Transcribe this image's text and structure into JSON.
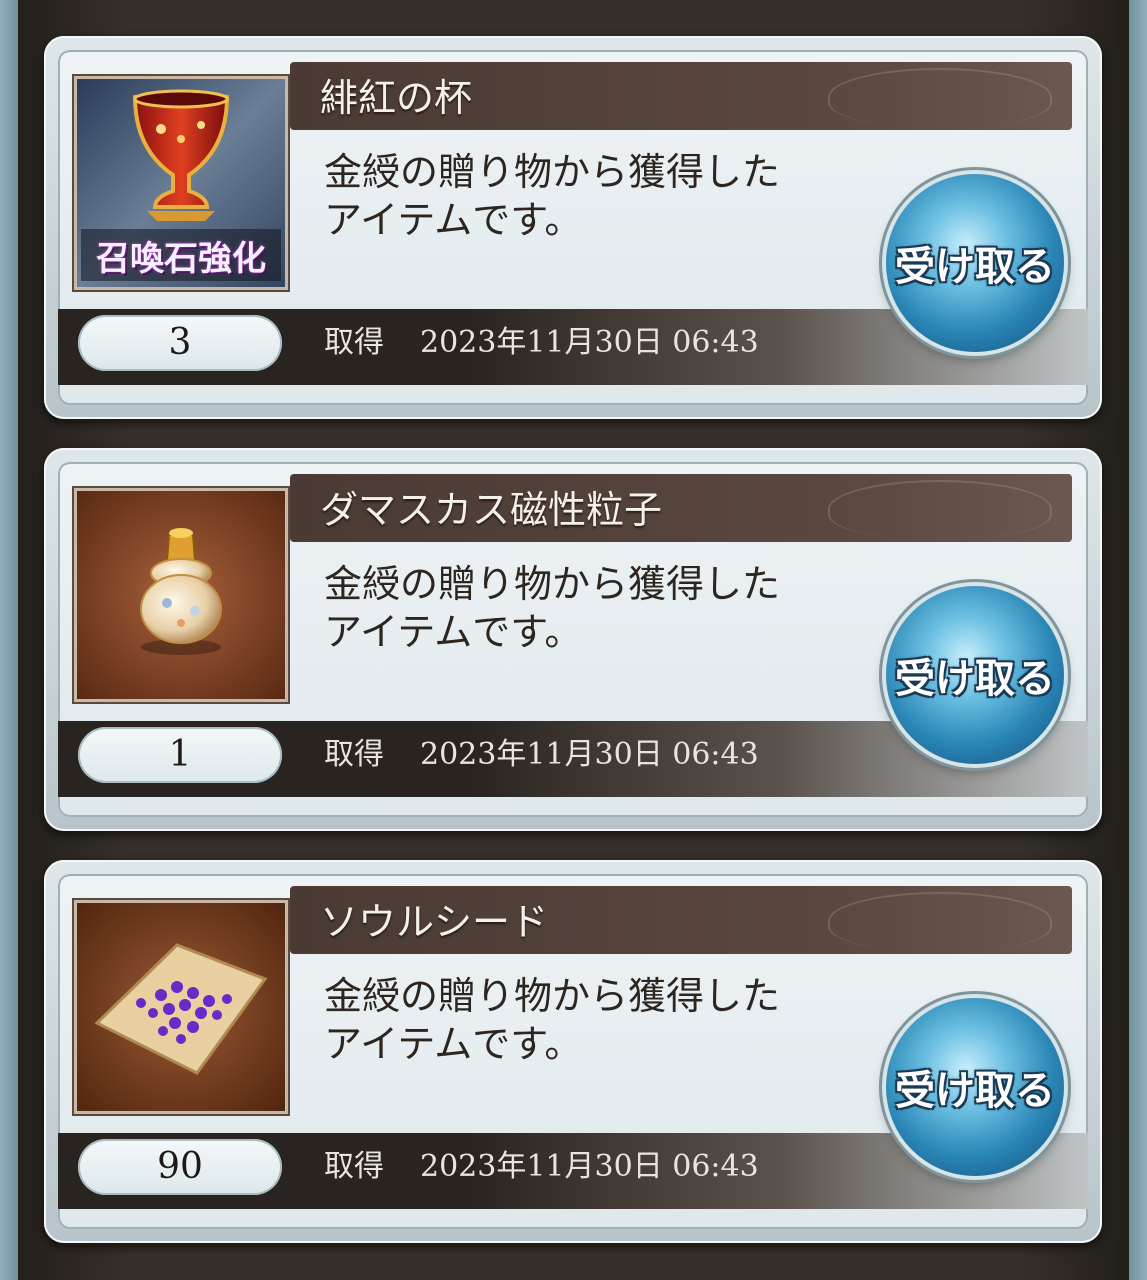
{
  "items": [
    {
      "title": "緋紅の杯",
      "description_line1": "金綬の贈り物から獲得した",
      "description_line2": "アイテムです。",
      "quantity": "3",
      "acquired_label": "取得",
      "acquired_date": "2023年11月30日 06:43",
      "receive_label": "受け取る",
      "icon_caption": "召喚石強化",
      "icon": "crimson-cup-icon"
    },
    {
      "title": "ダマスカス磁性粒子",
      "description_line1": "金綬の贈り物から獲得した",
      "description_line2": "アイテムです。",
      "quantity": "1",
      "acquired_label": "取得",
      "acquired_date": "2023年11月30日 06:43",
      "receive_label": "受け取る",
      "icon": "damascus-particle-icon"
    },
    {
      "title": "ソウルシード",
      "description_line1": "金綬の贈り物から獲得した",
      "description_line2": "アイテムです。",
      "quantity": "90",
      "acquired_label": "取得",
      "acquired_date": "2023年11月30日 06:43",
      "receive_label": "受け取る",
      "icon": "soul-seed-icon"
    }
  ]
}
